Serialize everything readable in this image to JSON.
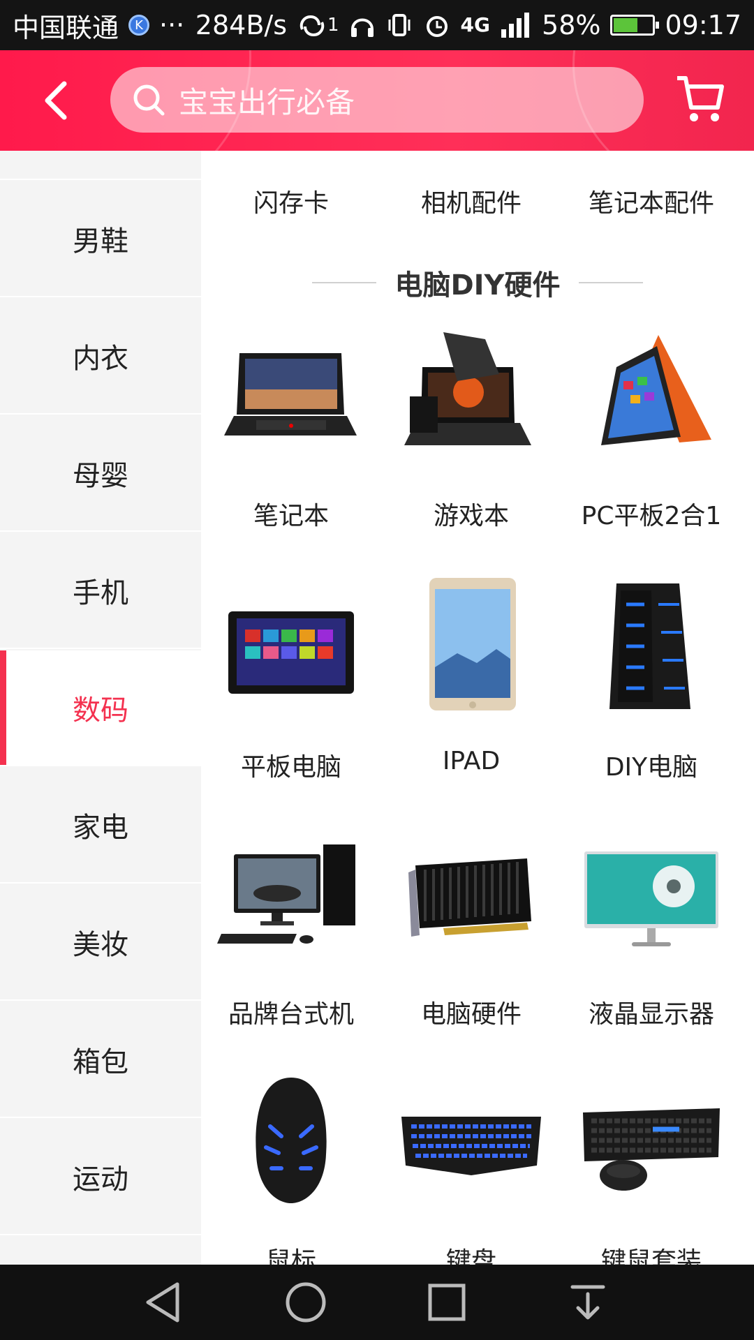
{
  "status_bar": {
    "carrier": "中国联通",
    "badge": "K",
    "dots": "···",
    "net_speed": "284B/s",
    "sync_count": "1",
    "network_type": "4G",
    "battery": "58%",
    "battery_level": 0.58,
    "time": "09:17"
  },
  "header": {
    "search_placeholder": "宝宝出行必备",
    "icons": [
      "back-arrow-icon",
      "search-icon",
      "cart-icon"
    ],
    "accent_color": "#ff1a4b"
  },
  "sidebar": {
    "items": [
      {
        "label": "男鞋"
      },
      {
        "label": "内衣"
      },
      {
        "label": "母婴"
      },
      {
        "label": "手机"
      },
      {
        "label": "数码",
        "active": true
      },
      {
        "label": "家电"
      },
      {
        "label": "美妆"
      },
      {
        "label": "箱包"
      },
      {
        "label": "运动"
      }
    ],
    "active_color": "#f4314f"
  },
  "content": {
    "top_row": [
      "闪存卡",
      "相机配件",
      "笔记本配件"
    ],
    "section_title": "电脑DIY硬件",
    "products": [
      {
        "label": "笔记本",
        "icon": "laptop-image"
      },
      {
        "label": "游戏本",
        "icon": "gaming-laptop-image"
      },
      {
        "label": "PC平板2合1",
        "icon": "convertible-laptop-image"
      },
      {
        "label": "平板电脑",
        "icon": "windows-tablet-image"
      },
      {
        "label": "IPAD",
        "icon": "ipad-image"
      },
      {
        "label": "DIY电脑",
        "icon": "pc-case-image"
      },
      {
        "label": "品牌台式机",
        "icon": "desktop-pc-image"
      },
      {
        "label": "电脑硬件",
        "icon": "graphics-card-image"
      },
      {
        "label": "液晶显示器",
        "icon": "monitor-image"
      },
      {
        "label": "鼠标",
        "icon": "mouse-image"
      },
      {
        "label": "键盘",
        "icon": "keyboard-image"
      },
      {
        "label": "键鼠套装",
        "icon": "keyboard-mouse-set-image"
      }
    ]
  },
  "nav_bar": {
    "buttons": [
      "back-icon",
      "home-icon",
      "recents-icon",
      "notifications-icon"
    ]
  }
}
